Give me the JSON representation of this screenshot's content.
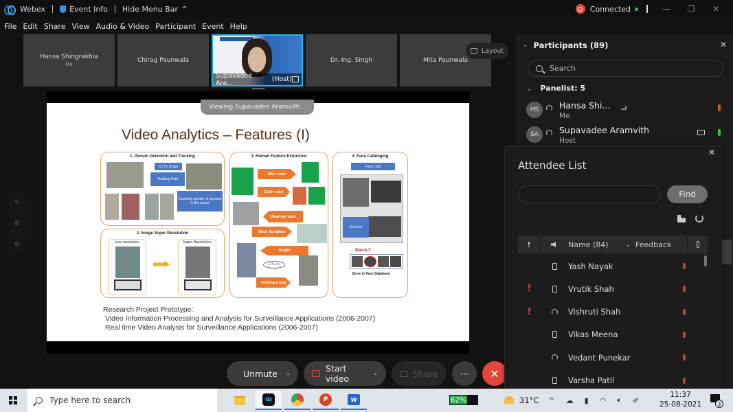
{
  "titlebar": {
    "app_name": "Webex",
    "event_info": "Event Info",
    "hide_menu": "Hide Menu Bar",
    "hide_menu_chevron": "^",
    "status": "Connected",
    "minimize": "—",
    "restore": "❐",
    "close": "✕"
  },
  "menu": [
    "File",
    "Edit",
    "Share",
    "View",
    "Audio & Video",
    "Participant",
    "Event",
    "Help"
  ],
  "filmstrip": {
    "tiles": [
      {
        "name": "Hansa Shingrakhia",
        "sub": "Me"
      },
      {
        "name": "Chirag Paunwala",
        "sub": ""
      },
      {
        "name": "Supavadee Ara...",
        "sub": "(Host)"
      },
      {
        "name": "Dr.-Ing. Singh",
        "sub": ""
      },
      {
        "name": "Mita Paunwala",
        "sub": ""
      }
    ],
    "layout_label": "Layout"
  },
  "stage": {
    "viewing_banner": "Viewing Supavadee Aramvith...",
    "slide": {
      "title": "Video Analytics – Features (I)",
      "panels": {
        "p1": {
          "title": "1. Person Detection and Tracking",
          "cctv": "CCTV image",
          "tracking": "Tracking Path",
          "counting": "Counting number of persons in the scene"
        },
        "p2": {
          "title": "2. Image Super Resolution",
          "low": "Low resolution",
          "super": "Super Resolution"
        },
        "p3": {
          "title": "3. Human Feature Extraction",
          "skin": "Skin color",
          "cloth": "Cloth color",
          "hood": "Wearing hood",
          "sunglass": "Wear Sunglass",
          "height": "Height",
          "height_value": "175 cm.",
          "bag": "Holding a bag"
        },
        "p4": {
          "title": "4. Face Cataloging",
          "face_crop": "Face crop",
          "zoom": "Zoom in",
          "match": "Match !!",
          "store": "Store in Face Database"
        }
      },
      "footer": {
        "l1": "Research Project Prototype:",
        "l2": "Video Information Processing and Analysis for Surveillance Applications (2006-2007)",
        "l3": "Real time Video Analysis for Surveillance Applications (2006-2007)"
      }
    }
  },
  "controls": {
    "unmute": "Unmute",
    "start_video": "Start video",
    "share": "Share",
    "more": "···",
    "end": "✕",
    "chevron": "⌄"
  },
  "participants": {
    "header": "Participants (89)",
    "search_placeholder": "Search",
    "panelist_label": "Panelist: 5",
    "panelists": [
      {
        "initials": "HS",
        "name": "Hansa Shi...",
        "role": "Me",
        "mic": "muted"
      },
      {
        "initials": "SA",
        "name": "Supavadee Aramvith",
        "role": "Host",
        "mic": "active"
      }
    ]
  },
  "attendee_list": {
    "title": "Attendee List",
    "find_button": "Find",
    "search_value": "",
    "columns": {
      "flag": "!",
      "name": "Name (84)",
      "feedback": "Feedback"
    },
    "rows": [
      {
        "name": "Yash Nayak",
        "flag": "",
        "device": "phone"
      },
      {
        "name": "Vrutik Shah",
        "flag": "!",
        "device": "phone"
      },
      {
        "name": "Vishruti Shah",
        "flag": "!",
        "device": "headset"
      },
      {
        "name": "Vikas Meena",
        "flag": "",
        "device": "phone"
      },
      {
        "name": "Vedant Punekar",
        "flag": "",
        "device": "headset"
      },
      {
        "name": "Varsha Patil",
        "flag": "",
        "device": "phone"
      }
    ]
  },
  "taskbar": {
    "search_placeholder": "Type here to search",
    "battery": "62%",
    "battery_level": 0.62,
    "weather": "31°C",
    "time": "11:37",
    "date": "25-08-2021",
    "notifications": "3"
  },
  "colors": {
    "accent_blue": "#1fb5e8",
    "end_red": "#e3473b",
    "connected_green": "#3bbd4c",
    "slide_orange": "#ec7a2e",
    "slide_blue": "#4a78c4"
  }
}
